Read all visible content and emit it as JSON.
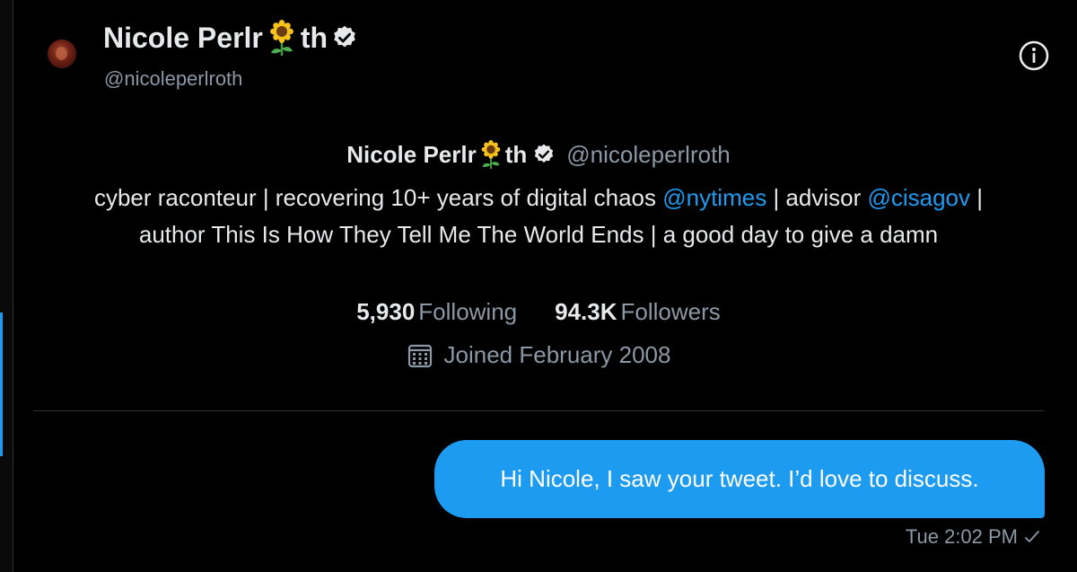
{
  "colors": {
    "background": "#000000",
    "accent": "#1d9bf0",
    "text": "#e7e9ea",
    "muted": "#8b98a5"
  },
  "header": {
    "name_prefix": "Nicole Perlr",
    "name_emoji": "sunflower-icon",
    "name_suffix": "th",
    "handle": "@nicoleperlroth",
    "info_icon": "info-icon"
  },
  "profile": {
    "name_prefix": "Nicole Perlr",
    "name_suffix": "th",
    "handle": "@nicoleperlroth",
    "bio": {
      "part1": "cyber raconteur | recovering 10+ years of digital chaos ",
      "mention1": "@nytimes",
      "part2": " | advisor ",
      "mention2": "@cisagov",
      "part3": " | author This Is How They Tell Me The World Ends | a good day to give a damn"
    },
    "following_count": "5,930",
    "following_label": "Following",
    "followers_count": "94.3K",
    "followers_label": "Followers",
    "joined": "Joined February 2008",
    "joined_icon": "calendar-icon"
  },
  "message": {
    "text": "Hi Nicole, I saw your tweet. I’d love to discuss.",
    "timestamp": "Tue 2:02 PM",
    "status_icon": "checkmark-icon"
  }
}
